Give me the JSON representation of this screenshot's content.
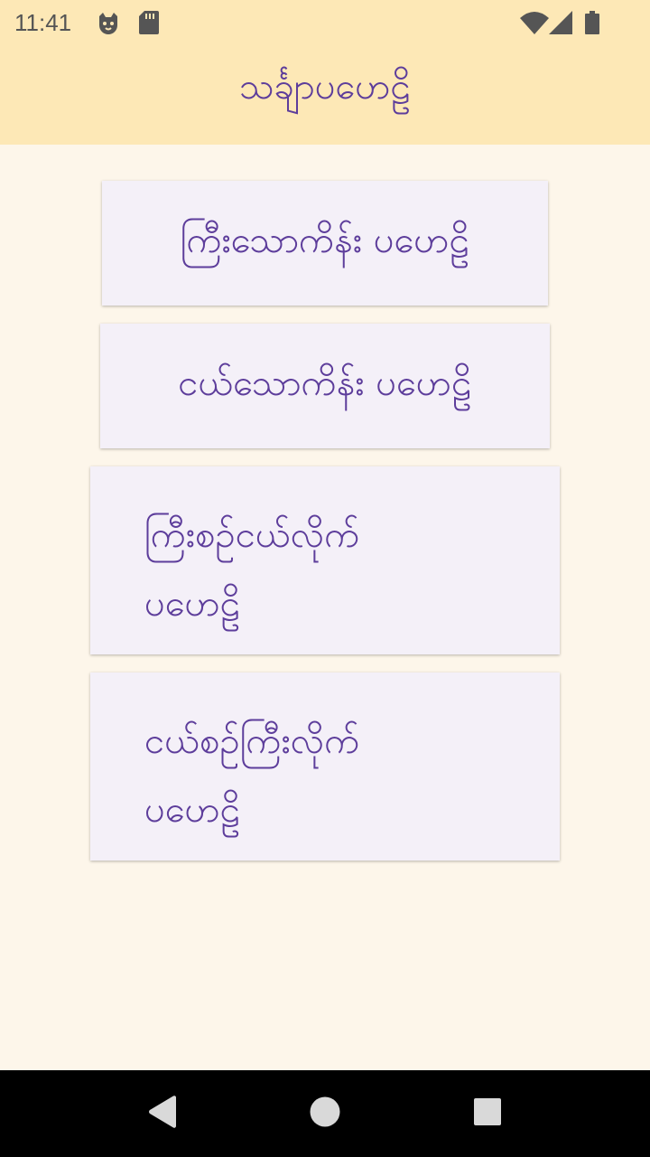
{
  "status_bar": {
    "time": "11:41",
    "icons": [
      "cat-face-icon",
      "sd-card-icon",
      "wifi-icon",
      "signal-icon",
      "battery-icon"
    ]
  },
  "app_bar": {
    "title": "သင်္ချာပဟေဠိ"
  },
  "menu": {
    "items": [
      {
        "label": "ကြီးသောကိန်း ပဟေဠိ"
      },
      {
        "label": "ငယ်သောကိန်း ပဟေဠိ"
      },
      {
        "label_line1": "ကြီးစဉ်ငယ်လိုက်",
        "label_line2": "ပဟေဠိ"
      },
      {
        "label_line1": "ငယ်စဉ်ကြီးလိုက်",
        "label_line2": "ပဟေဠိ"
      }
    ]
  },
  "nav_bar": {
    "buttons": [
      "back-icon",
      "home-icon",
      "recents-icon"
    ]
  },
  "colors": {
    "app_bar": "#fde8b6",
    "background": "#fdf6ea",
    "card": "#f4f0f8",
    "accent_text": "#5d3d9b",
    "nav_bar": "#000000"
  }
}
